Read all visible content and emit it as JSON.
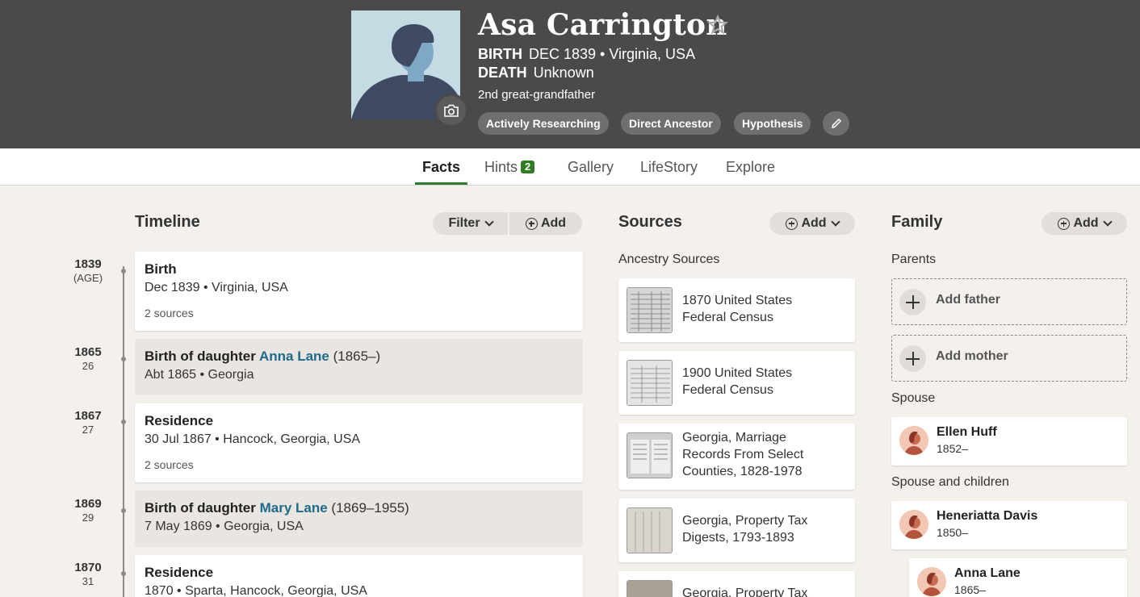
{
  "person": {
    "name": "Asa Carrington",
    "birth_label": "BIRTH",
    "birth_value": "DEC 1839 • Virginia, USA",
    "death_label": "DEATH",
    "death_value": "Unknown",
    "relation": "2nd great-grandfather",
    "tags": [
      "Actively Researching",
      "Direct Ancestor",
      "Hypothesis"
    ]
  },
  "tabs": [
    {
      "label": "Facts",
      "active": true
    },
    {
      "label": "Hints",
      "badge": "2"
    },
    {
      "label": "Gallery"
    },
    {
      "label": "LifeStory"
    },
    {
      "label": "Explore"
    }
  ],
  "timeline": {
    "title": "Timeline",
    "filter_label": "Filter",
    "add_label": "Add",
    "events": [
      {
        "year": "1839",
        "age": "(AGE)",
        "title": "Birth",
        "detail": "Dec 1839 • Virginia, USA",
        "sources": "2 sources"
      },
      {
        "year": "1865",
        "age": "26",
        "title_prefix": "Birth of daughter ",
        "title_link": "Anna Lane",
        "title_suffix": " (1865–)",
        "detail": "Abt 1865 • Georgia"
      },
      {
        "year": "1867",
        "age": "27",
        "title": "Residence",
        "detail": "30 Jul 1867 • Hancock, Georgia, USA",
        "sources": "2 sources"
      },
      {
        "year": "1869",
        "age": "29",
        "title_prefix": "Birth of daughter ",
        "title_link": "Mary Lane",
        "title_suffix": " (1869–1955)",
        "detail": "7 May 1869 • Georgia, USA"
      },
      {
        "year": "1870",
        "age": "31",
        "title": "Residence",
        "detail": "1870 • Sparta, Hancock, Georgia, USA"
      }
    ]
  },
  "sources": {
    "title": "Sources",
    "add_label": "Add",
    "subheading": "Ancestry Sources",
    "items": [
      {
        "line1": "1870 United States",
        "line2": "Federal Census"
      },
      {
        "line1": "1900 United States",
        "line2": "Federal Census"
      },
      {
        "line1": "Georgia, Marriage",
        "line2": "Records From Select",
        "line3": "Counties, 1828-1978"
      },
      {
        "line1": "Georgia, Property Tax",
        "line2": "Digests, 1793-1893"
      },
      {
        "line1": "Georgia, Property Tax"
      }
    ]
  },
  "family": {
    "title": "Family",
    "add_label": "Add",
    "parents_label": "Parents",
    "add_father": "Add father",
    "add_mother": "Add mother",
    "spouse_label": "Spouse",
    "spouse": {
      "name": "Ellen Huff",
      "dates": "1852–"
    },
    "spouse_children_label": "Spouse and children",
    "spouse2": {
      "name": "Heneriatta Davis",
      "dates": "1850–"
    },
    "child": {
      "name": "Anna Lane",
      "dates": "1865–"
    }
  },
  "colors": {
    "header_bg": "#4a4a4a",
    "accent_green": "#2f7d21",
    "link_blue": "#1d6a8c",
    "page_bg": "#f4f1ed"
  }
}
